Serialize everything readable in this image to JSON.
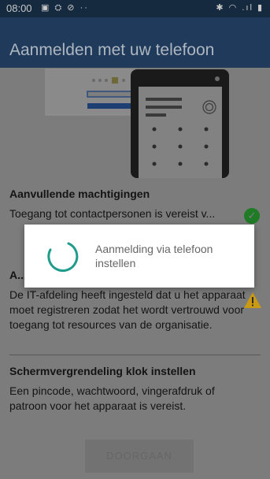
{
  "status_bar": {
    "time": "08:00",
    "left_icons": "▣ ⛭ ⊘  ··",
    "right_icons": "✱ ◠ .ıl ▮"
  },
  "app_bar": {
    "title": "Aanmelden met uw telefoon"
  },
  "sections": [
    {
      "heading": "Aanvullende machtigingen",
      "text": "Toegang tot contactpersonen is vereist v...",
      "status_icon": "check-icon"
    },
    {
      "heading": "A...",
      "text": "De IT-afdeling heeft ingesteld dat u het apparaat moet registreren zodat het wordt vertrouwd voor toegang tot resources van de organisatie.",
      "status_icon": "warning-icon"
    },
    {
      "heading": "Schermvergrendeling klok instellen",
      "text": "Een pincode, wachtwoord, vingerafdruk of patroon voor het apparaat is vereist."
    }
  ],
  "continue_button": {
    "label": "DOORGAAN"
  },
  "progress_dialog": {
    "message": "Aanmelding via telefoon instellen"
  },
  "colors": {
    "status_bar": "#15293f",
    "app_bar": "#1f3a5a",
    "spinner": "#1f9c8b",
    "success": "#1f7b26",
    "warning": "#c99a12"
  }
}
